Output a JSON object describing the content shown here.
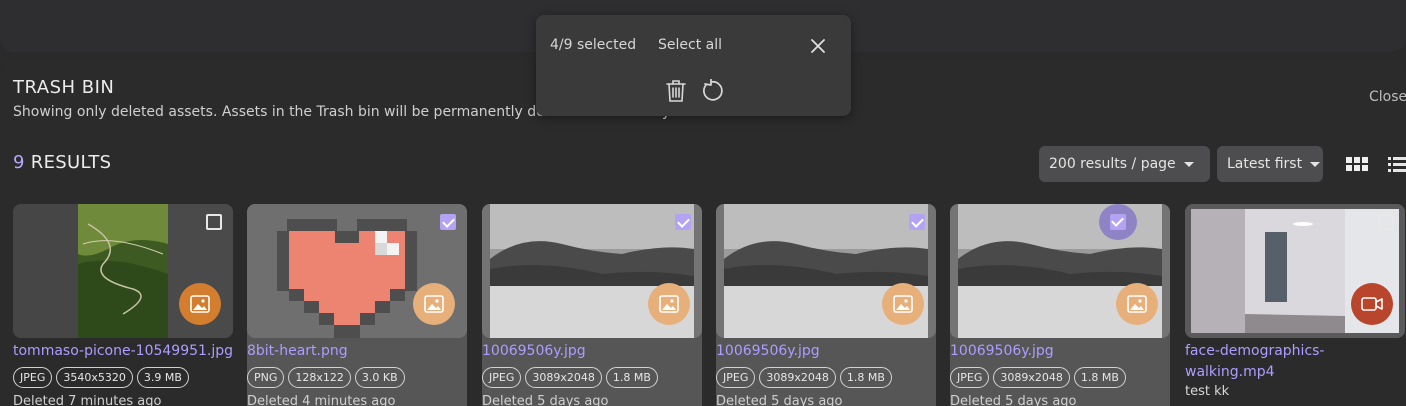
{
  "header": {
    "title": "TRASH BIN",
    "subtitle": "Showing only deleted assets. Assets in the Trash bin will be permanently deleted after 14 days.",
    "close_label": "Close"
  },
  "results": {
    "count": "9",
    "label": "RESULTS"
  },
  "controls": {
    "per_page": "200 results / page",
    "sort": "Latest first"
  },
  "selection_popup": {
    "count": "4/9 selected",
    "select_all": "Select all"
  },
  "colors": {
    "accent": "#b7a6ff",
    "image_badge": "#d37e2e",
    "video_badge": "#b8452c",
    "checkbox_on": "#b3a3f2"
  },
  "assets": [
    {
      "name": "tommaso-picone-10549951.jpg",
      "format": "JPEG",
      "dimensions": "3540x5320",
      "size": "3.9 MB",
      "deleted": "Deleted 7 minutes ago",
      "selected": false,
      "icon": "image-icon"
    },
    {
      "name": "8bit-heart.png",
      "format": "PNG",
      "dimensions": "128x122",
      "size": "3.0 KB",
      "deleted": "Deleted 4 minutes ago",
      "selected": true,
      "icon": "image-icon"
    },
    {
      "name": "10069506y.jpg",
      "format": "JPEG",
      "dimensions": "3089x2048",
      "size": "1.8 MB",
      "deleted": "Deleted 5 days ago",
      "selected": true,
      "icon": "image-icon"
    },
    {
      "name": "10069506y.jpg",
      "format": "JPEG",
      "dimensions": "3089x2048",
      "size": "1.8 MB",
      "deleted": "Deleted 5 days ago",
      "selected": true,
      "icon": "image-icon"
    },
    {
      "name": "10069506y.jpg",
      "format": "JPEG",
      "dimensions": "3089x2048",
      "size": "1.8 MB",
      "deleted": "Deleted 5 days ago",
      "selected": true,
      "icon": "image-icon"
    },
    {
      "name": "face-demographics-walking.mp4",
      "description": "test kk",
      "selected": false,
      "icon": "video-icon"
    }
  ]
}
